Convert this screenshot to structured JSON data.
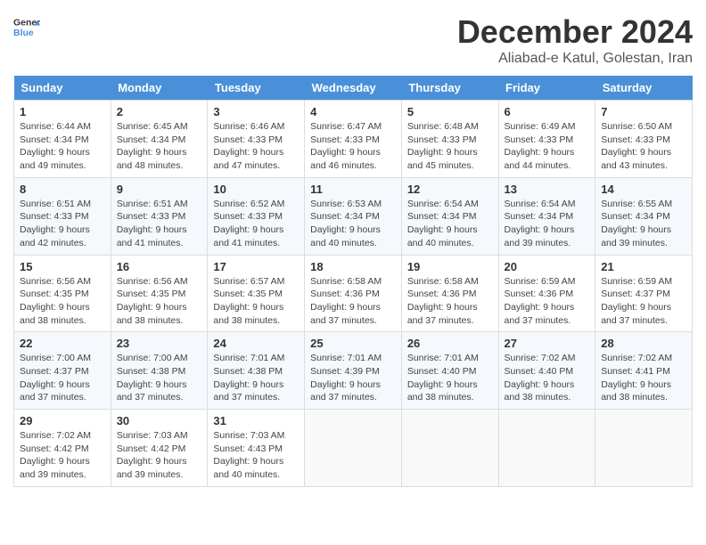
{
  "logo": {
    "general": "General",
    "blue": "Blue"
  },
  "header": {
    "month": "December 2024",
    "location": "Aliabad-e Katul, Golestan, Iran"
  },
  "weekdays": [
    "Sunday",
    "Monday",
    "Tuesday",
    "Wednesday",
    "Thursday",
    "Friday",
    "Saturday"
  ],
  "weeks": [
    [
      {
        "day": "1",
        "sunrise": "6:44 AM",
        "sunset": "4:34 PM",
        "daylight": "9 hours and 49 minutes."
      },
      {
        "day": "2",
        "sunrise": "6:45 AM",
        "sunset": "4:34 PM",
        "daylight": "9 hours and 48 minutes."
      },
      {
        "day": "3",
        "sunrise": "6:46 AM",
        "sunset": "4:33 PM",
        "daylight": "9 hours and 47 minutes."
      },
      {
        "day": "4",
        "sunrise": "6:47 AM",
        "sunset": "4:33 PM",
        "daylight": "9 hours and 46 minutes."
      },
      {
        "day": "5",
        "sunrise": "6:48 AM",
        "sunset": "4:33 PM",
        "daylight": "9 hours and 45 minutes."
      },
      {
        "day": "6",
        "sunrise": "6:49 AM",
        "sunset": "4:33 PM",
        "daylight": "9 hours and 44 minutes."
      },
      {
        "day": "7",
        "sunrise": "6:50 AM",
        "sunset": "4:33 PM",
        "daylight": "9 hours and 43 minutes."
      }
    ],
    [
      {
        "day": "8",
        "sunrise": "6:51 AM",
        "sunset": "4:33 PM",
        "daylight": "9 hours and 42 minutes."
      },
      {
        "day": "9",
        "sunrise": "6:51 AM",
        "sunset": "4:33 PM",
        "daylight": "9 hours and 41 minutes."
      },
      {
        "day": "10",
        "sunrise": "6:52 AM",
        "sunset": "4:33 PM",
        "daylight": "9 hours and 41 minutes."
      },
      {
        "day": "11",
        "sunrise": "6:53 AM",
        "sunset": "4:34 PM",
        "daylight": "9 hours and 40 minutes."
      },
      {
        "day": "12",
        "sunrise": "6:54 AM",
        "sunset": "4:34 PM",
        "daylight": "9 hours and 40 minutes."
      },
      {
        "day": "13",
        "sunrise": "6:54 AM",
        "sunset": "4:34 PM",
        "daylight": "9 hours and 39 minutes."
      },
      {
        "day": "14",
        "sunrise": "6:55 AM",
        "sunset": "4:34 PM",
        "daylight": "9 hours and 39 minutes."
      }
    ],
    [
      {
        "day": "15",
        "sunrise": "6:56 AM",
        "sunset": "4:35 PM",
        "daylight": "9 hours and 38 minutes."
      },
      {
        "day": "16",
        "sunrise": "6:56 AM",
        "sunset": "4:35 PM",
        "daylight": "9 hours and 38 minutes."
      },
      {
        "day": "17",
        "sunrise": "6:57 AM",
        "sunset": "4:35 PM",
        "daylight": "9 hours and 38 minutes."
      },
      {
        "day": "18",
        "sunrise": "6:58 AM",
        "sunset": "4:36 PM",
        "daylight": "9 hours and 37 minutes."
      },
      {
        "day": "19",
        "sunrise": "6:58 AM",
        "sunset": "4:36 PM",
        "daylight": "9 hours and 37 minutes."
      },
      {
        "day": "20",
        "sunrise": "6:59 AM",
        "sunset": "4:36 PM",
        "daylight": "9 hours and 37 minutes."
      },
      {
        "day": "21",
        "sunrise": "6:59 AM",
        "sunset": "4:37 PM",
        "daylight": "9 hours and 37 minutes."
      }
    ],
    [
      {
        "day": "22",
        "sunrise": "7:00 AM",
        "sunset": "4:37 PM",
        "daylight": "9 hours and 37 minutes."
      },
      {
        "day": "23",
        "sunrise": "7:00 AM",
        "sunset": "4:38 PM",
        "daylight": "9 hours and 37 minutes."
      },
      {
        "day": "24",
        "sunrise": "7:01 AM",
        "sunset": "4:38 PM",
        "daylight": "9 hours and 37 minutes."
      },
      {
        "day": "25",
        "sunrise": "7:01 AM",
        "sunset": "4:39 PM",
        "daylight": "9 hours and 37 minutes."
      },
      {
        "day": "26",
        "sunrise": "7:01 AM",
        "sunset": "4:40 PM",
        "daylight": "9 hours and 38 minutes."
      },
      {
        "day": "27",
        "sunrise": "7:02 AM",
        "sunset": "4:40 PM",
        "daylight": "9 hours and 38 minutes."
      },
      {
        "day": "28",
        "sunrise": "7:02 AM",
        "sunset": "4:41 PM",
        "daylight": "9 hours and 38 minutes."
      }
    ],
    [
      {
        "day": "29",
        "sunrise": "7:02 AM",
        "sunset": "4:42 PM",
        "daylight": "9 hours and 39 minutes."
      },
      {
        "day": "30",
        "sunrise": "7:03 AM",
        "sunset": "4:42 PM",
        "daylight": "9 hours and 39 minutes."
      },
      {
        "day": "31",
        "sunrise": "7:03 AM",
        "sunset": "4:43 PM",
        "daylight": "9 hours and 40 minutes."
      },
      null,
      null,
      null,
      null
    ]
  ]
}
